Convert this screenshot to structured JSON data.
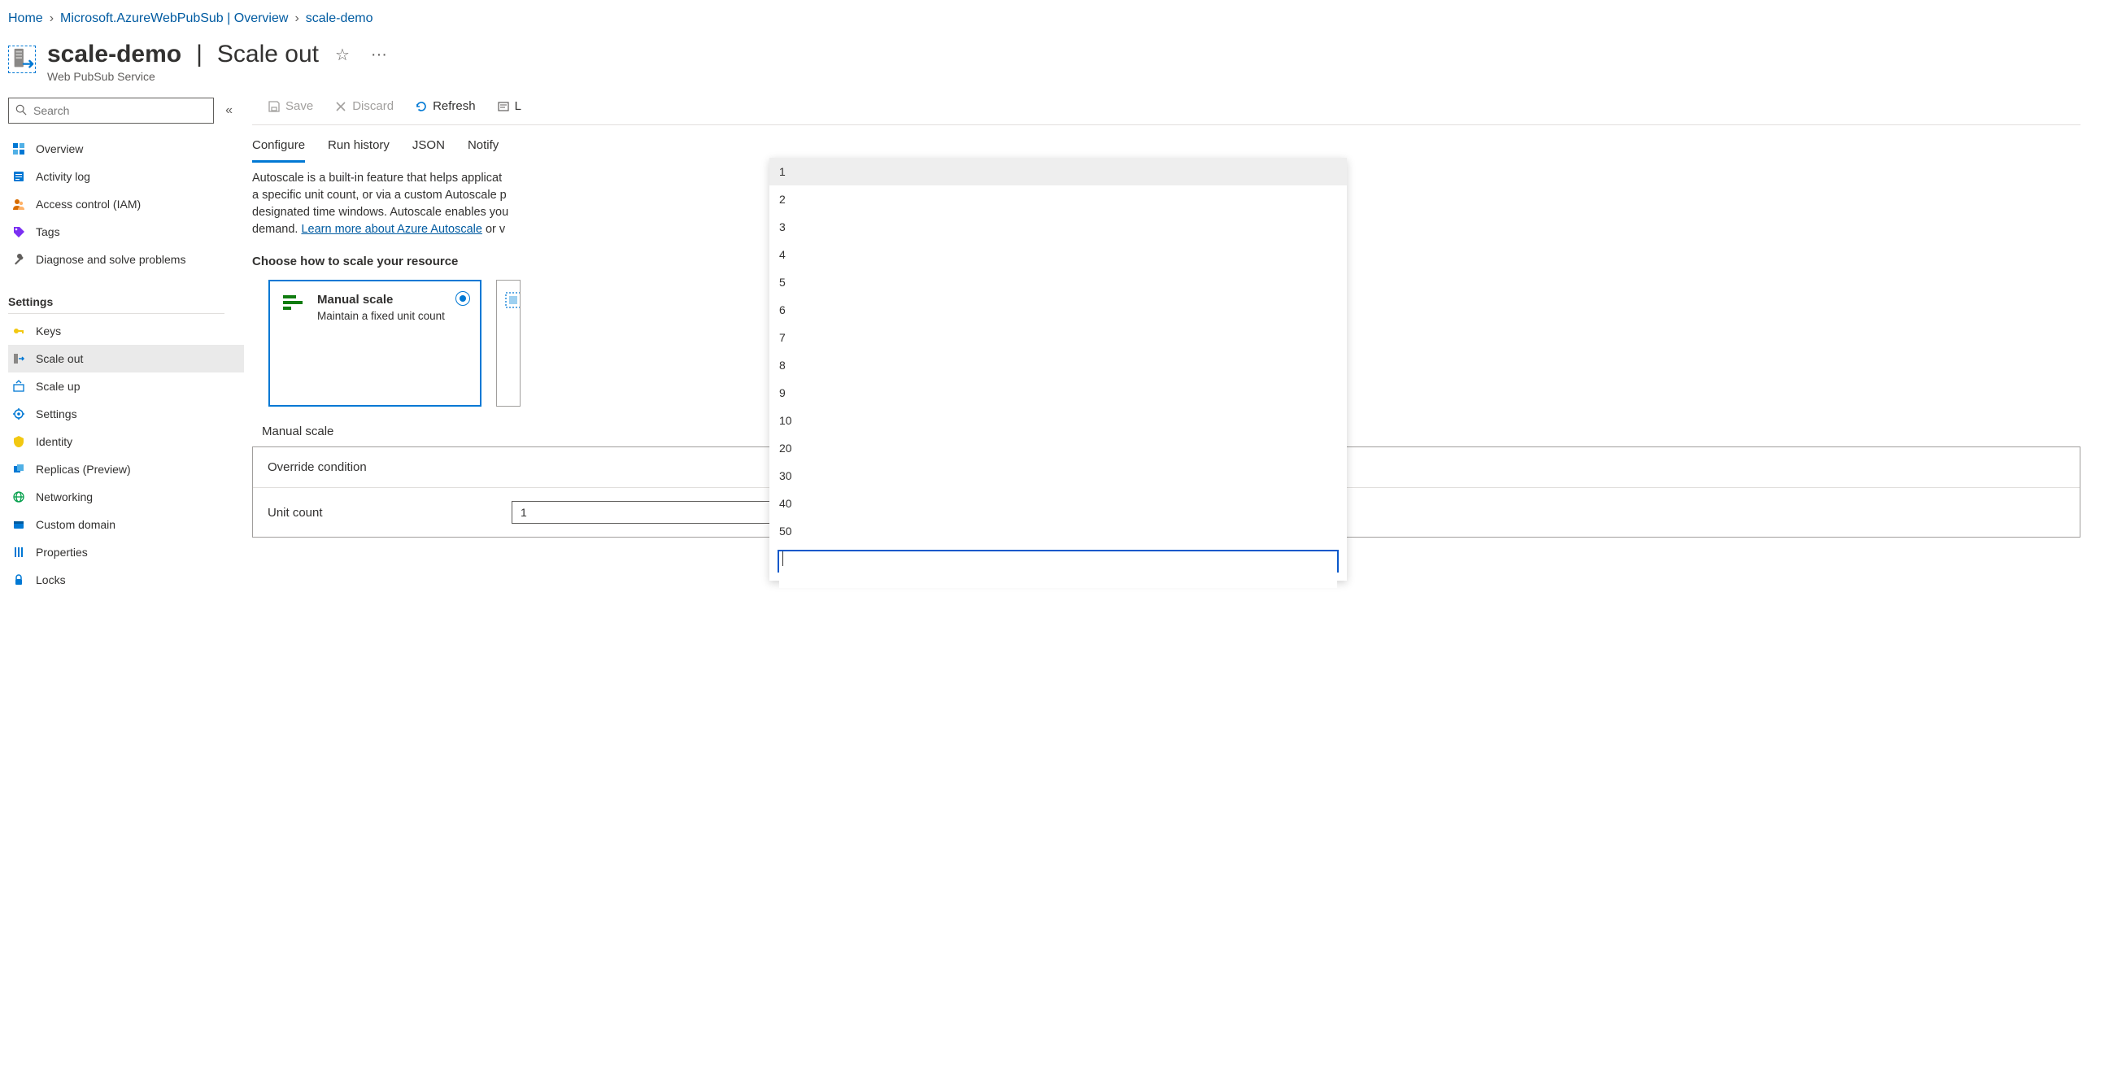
{
  "breadcrumb": [
    {
      "label": "Home"
    },
    {
      "label": "Microsoft.AzureWebPubSub | Overview"
    },
    {
      "label": "scale-demo"
    }
  ],
  "header": {
    "title": "scale-demo",
    "section": "Scale out",
    "subtype": "Web PubSub Service"
  },
  "search": {
    "placeholder": "Search"
  },
  "sidebar": {
    "top": [
      {
        "key": "overview",
        "label": "Overview"
      },
      {
        "key": "activity",
        "label": "Activity log"
      },
      {
        "key": "iam",
        "label": "Access control (IAM)"
      },
      {
        "key": "tags",
        "label": "Tags"
      },
      {
        "key": "diagnose",
        "label": "Diagnose and solve problems"
      }
    ],
    "groups": [
      {
        "title": "Settings",
        "items": [
          {
            "key": "keys",
            "label": "Keys"
          },
          {
            "key": "scaleout",
            "label": "Scale out",
            "selected": true
          },
          {
            "key": "scaleup",
            "label": "Scale up"
          },
          {
            "key": "settings",
            "label": "Settings"
          },
          {
            "key": "identity",
            "label": "Identity"
          },
          {
            "key": "replicas",
            "label": "Replicas (Preview)"
          },
          {
            "key": "networking",
            "label": "Networking"
          },
          {
            "key": "customdomain",
            "label": "Custom domain"
          },
          {
            "key": "properties",
            "label": "Properties"
          },
          {
            "key": "locks",
            "label": "Locks"
          }
        ]
      }
    ]
  },
  "toolbar": {
    "save": "Save",
    "discard": "Discard",
    "refresh": "Refresh",
    "logs_partial": "L"
  },
  "tabs": [
    "Configure",
    "Run history",
    "JSON",
    "Notify"
  ],
  "active_tab": 0,
  "intro": {
    "line1": "Autoscale is a built-in feature that helps applicat",
    "line2": "a specific unit count, or via a custom Autoscale p",
    "line3": "designated time windows. Autoscale enables you",
    "line4_pre": "demand. ",
    "link": "Learn more about Azure Autoscale",
    "line4_post": " or v"
  },
  "choose_head": "Choose how to scale your resource",
  "card_manual": {
    "title": "Manual scale",
    "desc": "Maintain a fixed unit count"
  },
  "manual_section": "Manual scale",
  "form": {
    "override_label": "Override condition",
    "unit_label": "Unit count",
    "unit_value": "1"
  },
  "dropdown": {
    "options": [
      "1",
      "2",
      "3",
      "4",
      "5",
      "6",
      "7",
      "8",
      "9",
      "10",
      "20",
      "30",
      "40",
      "50"
    ],
    "selected_index": 0,
    "filter_value": ""
  }
}
